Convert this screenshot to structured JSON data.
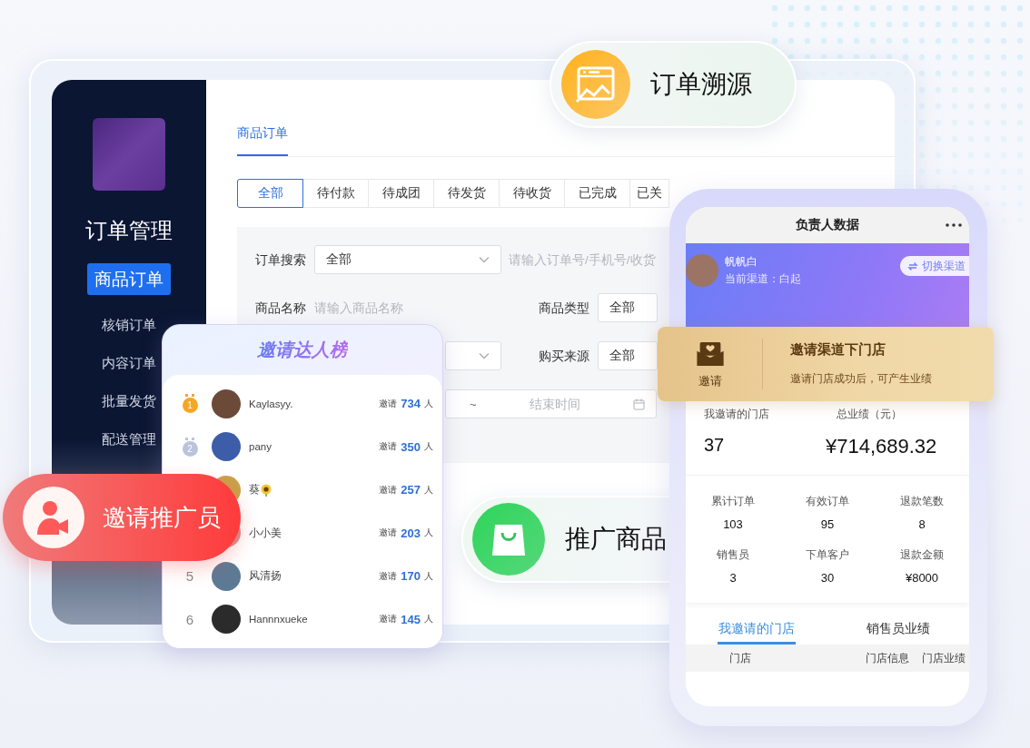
{
  "admin": {
    "sidebar": {
      "title": "订单管理",
      "items": [
        {
          "label": "商品订单",
          "selected": true
        },
        {
          "label": "核销订单",
          "selected": false
        },
        {
          "label": "内容订单",
          "selected": false
        },
        {
          "label": "批量发货",
          "selected": false
        },
        {
          "label": "配送管理",
          "selected": false
        }
      ]
    },
    "tabs": [
      {
        "label": "商品订单",
        "selected": true
      }
    ],
    "status_tabs": [
      {
        "label": "全部",
        "selected": true
      },
      {
        "label": "待付款",
        "selected": false
      },
      {
        "label": "待成团",
        "selected": false
      },
      {
        "label": "待发货",
        "selected": false
      },
      {
        "label": "待收货",
        "selected": false
      },
      {
        "label": "已完成",
        "selected": false
      },
      {
        "label": "已关",
        "selected": false
      }
    ],
    "filter_rows": [
      [
        {
          "kind": "select",
          "label": "订单搜索",
          "value": "全部"
        },
        {
          "kind": "input",
          "placeholder": "请输入订单号/手机号/收货"
        }
      ],
      [
        {
          "kind": "input",
          "label": "商品名称",
          "placeholder": "请输入商品名称"
        },
        {
          "kind": "select",
          "label": "商品类型",
          "value": "全部"
        }
      ],
      [
        {
          "kind": "select"
        },
        {
          "kind": "select",
          "label": "购买来源",
          "value": "全部"
        }
      ],
      [
        {
          "kind": "date_range",
          "separator": "~",
          "end_placeholder": "结束时间"
        }
      ]
    ]
  },
  "leaderboard": {
    "title": "邀请达人榜",
    "rows": [
      {
        "kind": "medal",
        "rank": "1",
        "color": "#f5a623",
        "name": "Kaylasyy.",
        "invite_label": "邀请",
        "count": "734",
        "unit": "人"
      },
      {
        "kind": "medal",
        "rank": "2",
        "color": "#b9c4dc",
        "name": "pany",
        "invite_label": "邀请",
        "count": "350",
        "unit": "人"
      },
      {
        "kind": "hidden",
        "name": "葵",
        "flower": true,
        "invite_label": "邀请",
        "count": "257",
        "unit": "人"
      },
      {
        "kind": "hidden",
        "name": "小小美",
        "invite_label": "邀请",
        "count": "203",
        "unit": "人"
      },
      {
        "kind": "number",
        "rank": "5",
        "name": "风清扬",
        "invite_label": "邀请",
        "count": "170",
        "unit": "人"
      },
      {
        "kind": "number",
        "rank": "6",
        "name": "Hannnxueke",
        "invite_label": "邀请",
        "count": "145",
        "unit": "人"
      }
    ]
  },
  "badges": [
    {
      "kind": "trace",
      "label": "订单溯源"
    },
    {
      "kind": "promoter",
      "label": "邀请推广员"
    },
    {
      "kind": "product",
      "label": "推广商品"
    }
  ],
  "phone": {
    "title": "负责人数据",
    "user": {
      "name": "帆帆白",
      "channel": "当前渠道：白起"
    },
    "switch_button": "切换渠道",
    "invite_banner": {
      "icon_label": "邀请",
      "title": "邀请渠道下门店",
      "subtitle": "邀请门店成功后，可产生业绩"
    },
    "summary": [
      {
        "label": "我邀请的门店",
        "value": "37"
      },
      {
        "label": "总业绩（元）",
        "value": "¥714,689.32"
      }
    ],
    "stats": [
      {
        "label": "累计订单",
        "value": "103"
      },
      {
        "label": "有效订单",
        "value": "95"
      },
      {
        "label": "退款笔数",
        "value": "8"
      },
      {
        "label": "销售员",
        "value": "3"
      },
      {
        "label": "下单客户",
        "value": "30"
      },
      {
        "label": "退款金额",
        "value": "¥8000"
      }
    ],
    "tabs": [
      {
        "label": "我邀请的门店",
        "selected": true
      },
      {
        "label": "销售员业绩",
        "selected": false
      }
    ],
    "table_columns": [
      "门店",
      "门店信息",
      "门店业绩"
    ]
  }
}
